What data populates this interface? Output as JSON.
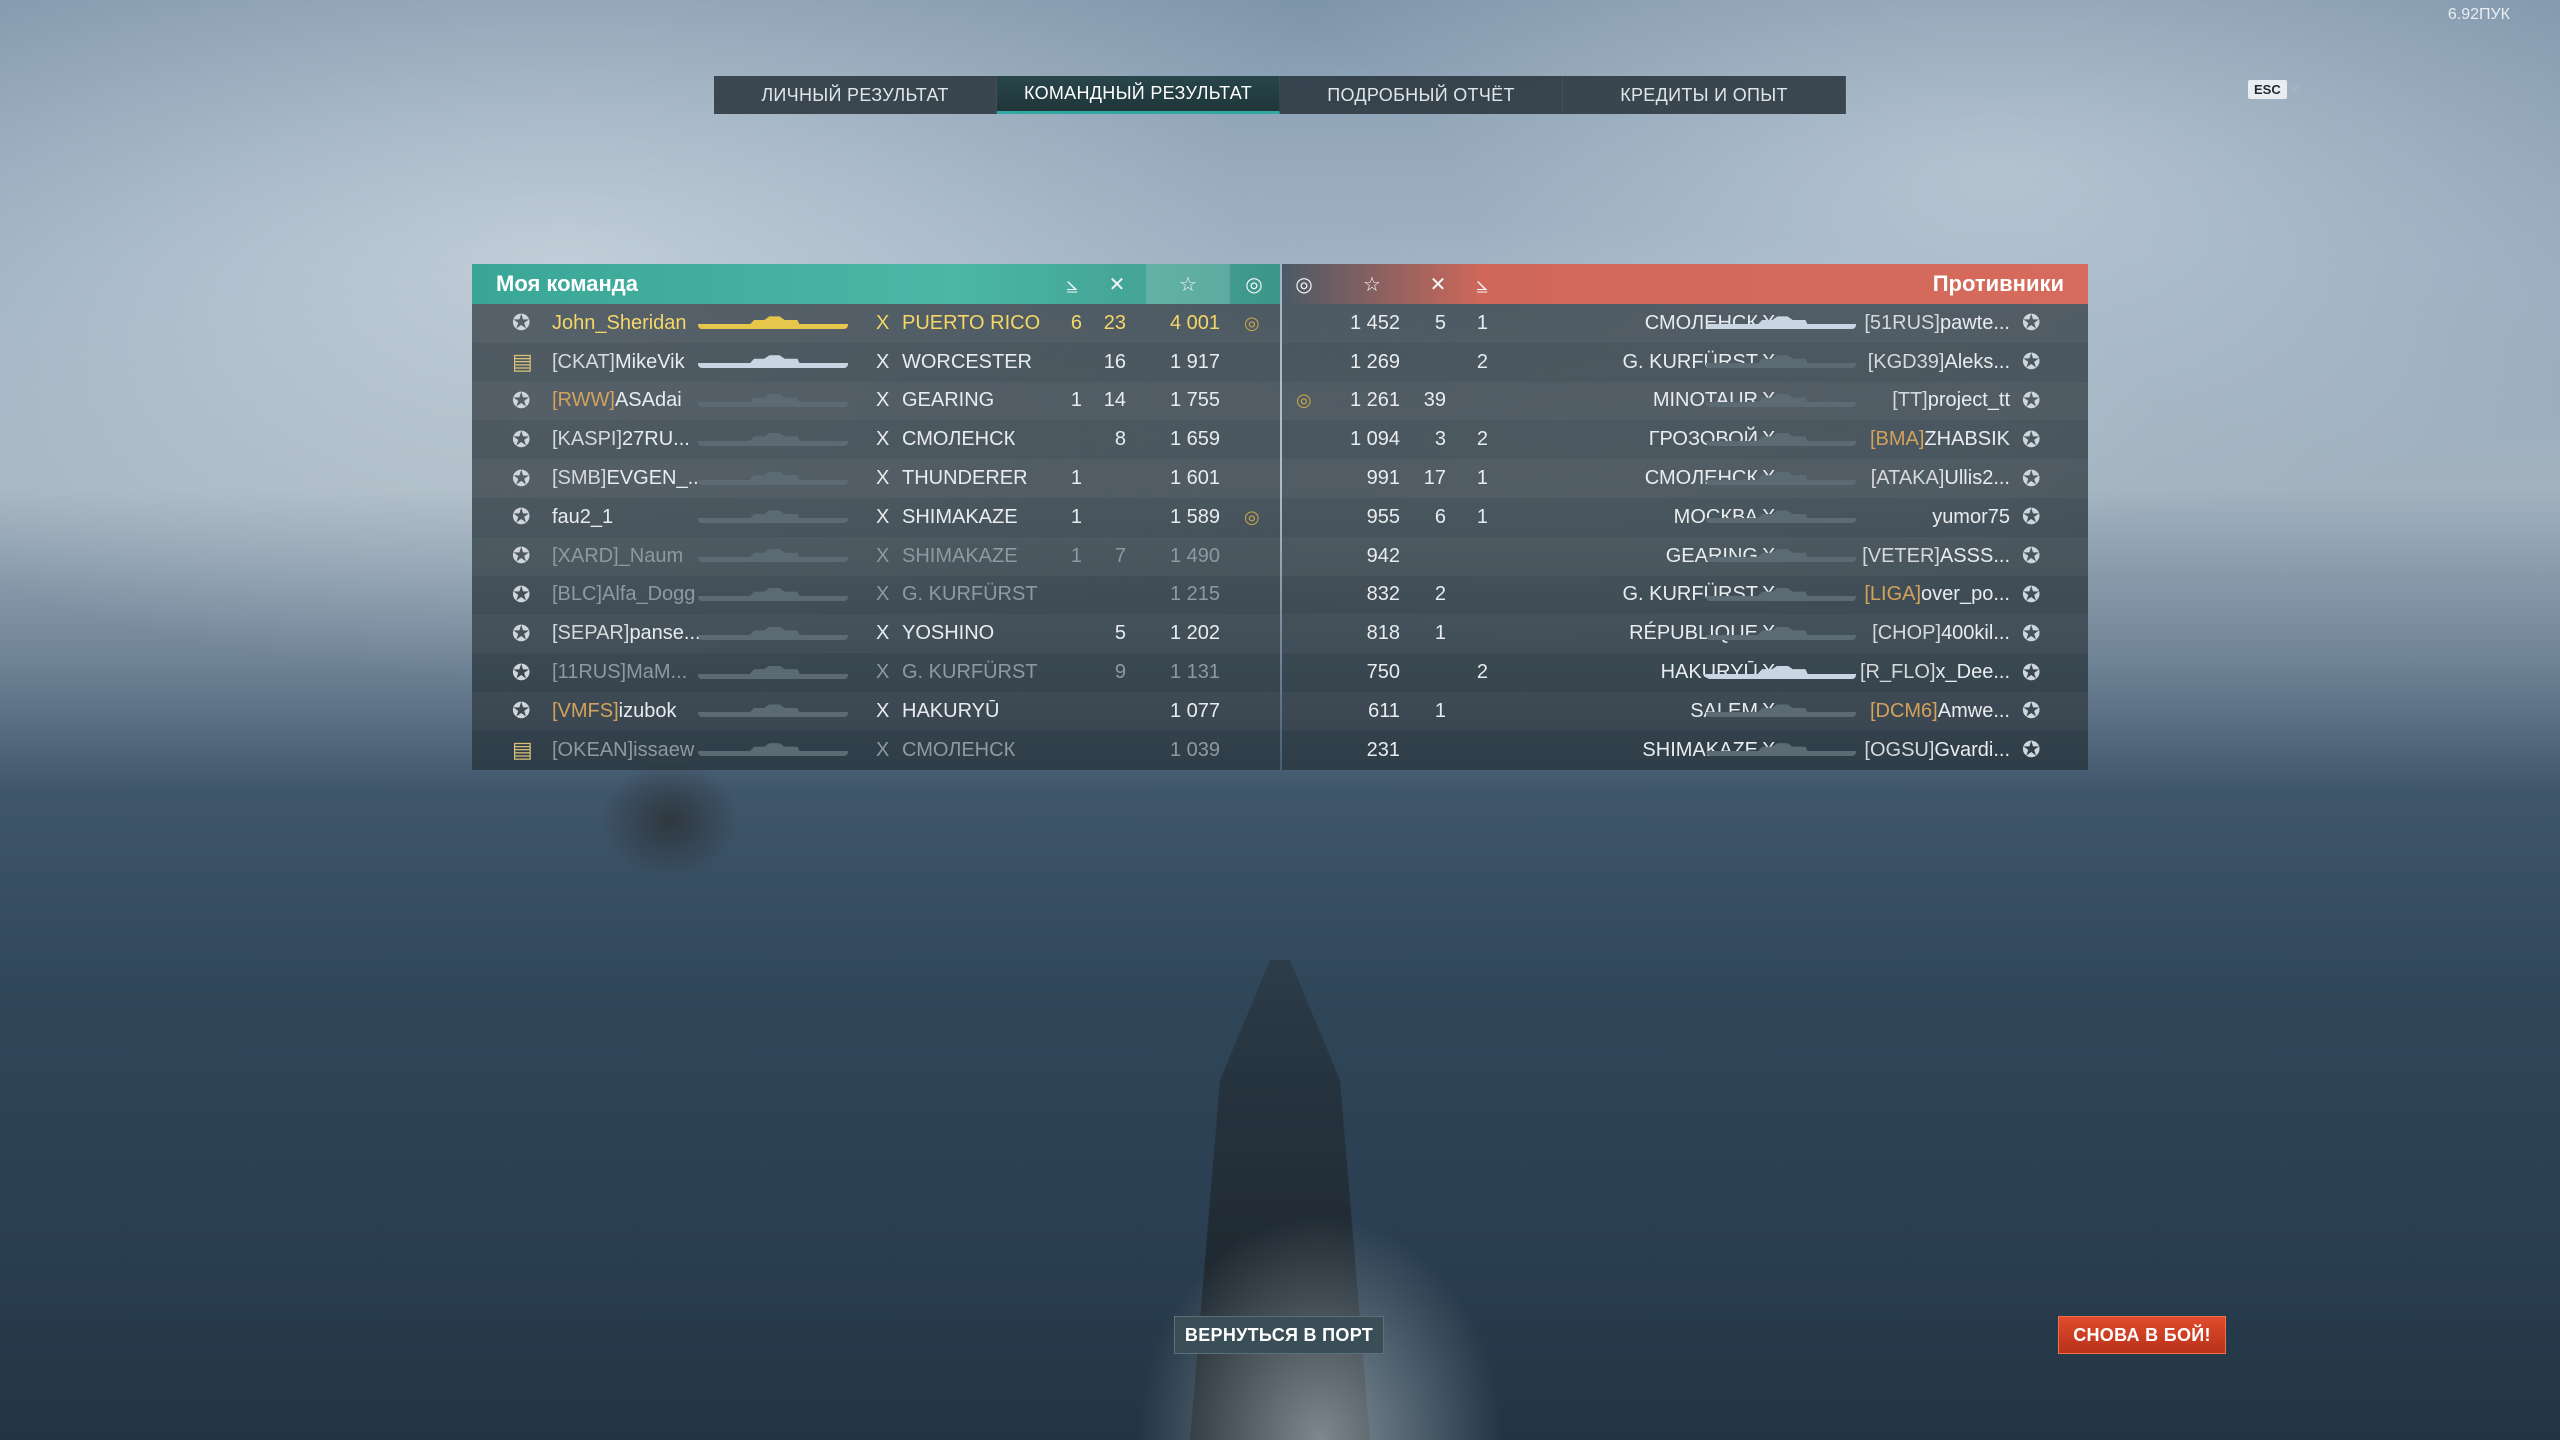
{
  "version": "6.92ПУК",
  "esc_label": "ESC",
  "close_glyph": "×",
  "tabs": [
    {
      "label": "ЛИЧНЫЙ РЕЗУЛЬТАТ",
      "active": false
    },
    {
      "label": "КОМАНДНЫЙ РЕЗУЛЬТАТ",
      "active": true
    },
    {
      "label": "ПОДРОБНЫЙ ОТЧЁТ",
      "active": false
    },
    {
      "label": "КРЕДИТЫ И ОПЫТ",
      "active": false
    }
  ],
  "my_team": {
    "title": "Моя команда",
    "header_icons": {
      "planes": "⦥",
      "kills": "✕",
      "xp": "☆",
      "base": "◎"
    },
    "rows": [
      {
        "clan": "",
        "player": "John_Sheridan",
        "tier": "X",
        "ship": "PUERTO RICO",
        "planes": "6",
        "kills": "23",
        "xp": "4 001",
        "base": "◎",
        "me": true
      },
      {
        "clan": "[CKAT]",
        "player": "MikeVik",
        "tier": "X",
        "ship": "WORCESTER",
        "planes": "",
        "kills": "16",
        "xp": "1 917",
        "base": ""
      },
      {
        "clan": "[RWW]",
        "player": "ASAdai",
        "tier": "X",
        "ship": "GEARING",
        "planes": "1",
        "kills": "14",
        "xp": "1 755",
        "base": "",
        "gold": true
      },
      {
        "clan": "[KASPI]",
        "player": "27RU...",
        "tier": "X",
        "ship": "СМОЛЕНСК",
        "planes": "",
        "kills": "8",
        "xp": "1 659",
        "base": ""
      },
      {
        "clan": "[SMB]",
        "player": "EVGEN_...",
        "tier": "X",
        "ship": "THUNDERER",
        "planes": "1",
        "kills": "",
        "xp": "1 601",
        "base": ""
      },
      {
        "clan": "",
        "player": "fau2_1",
        "tier": "X",
        "ship": "SHIMAKAZE",
        "planes": "1",
        "kills": "",
        "xp": "1 589",
        "base": "◎"
      },
      {
        "clan": "[XARD]",
        "player": "_Naum",
        "tier": "X",
        "ship": "SHIMAKAZE",
        "planes": "1",
        "kills": "7",
        "xp": "1 490",
        "base": "",
        "dead": true
      },
      {
        "clan": "[BLC]",
        "player": "Alfa_Dogg",
        "tier": "X",
        "ship": "G. KURFÜRST",
        "planes": "",
        "kills": "",
        "xp": "1 215",
        "base": "",
        "dead": true,
        "gold": true
      },
      {
        "clan": "[SEPAR]",
        "player": "panse...",
        "tier": "X",
        "ship": "YOSHINO",
        "planes": "",
        "kills": "5",
        "xp": "1 202",
        "base": ""
      },
      {
        "clan": "[11RUS]",
        "player": "MaM...",
        "tier": "X",
        "ship": "G. KURFÜRST",
        "planes": "",
        "kills": "9",
        "xp": "1 131",
        "base": "",
        "dead": true,
        "gold": true
      },
      {
        "clan": "[VMFS]",
        "player": "izubok",
        "tier": "X",
        "ship": "HAKURYŪ",
        "planes": "",
        "kills": "",
        "xp": "1 077",
        "base": "",
        "gold": true
      },
      {
        "clan": "[OKEAN]",
        "player": "issaew",
        "tier": "X",
        "ship": "СМОЛЕНСК",
        "planes": "",
        "kills": "",
        "xp": "1 039",
        "base": "",
        "dead": true
      }
    ]
  },
  "enemy_team": {
    "title": "Противники",
    "rows": [
      {
        "base": "",
        "xp": "1 452",
        "kills": "5",
        "planes": "1",
        "ship": "СМОЛЕНСК",
        "tier": "X",
        "clan": "[51RUS]",
        "player": "pawte..."
      },
      {
        "base": "",
        "xp": "1 269",
        "kills": "",
        "planes": "2",
        "ship": "G. KURFÜRST",
        "tier": "X",
        "clan": "[KGD39]",
        "player": "Aleks..."
      },
      {
        "base": "◎",
        "xp": "1 261",
        "kills": "39",
        "planes": "",
        "ship": "MINOTAUR",
        "tier": "X",
        "clan": "[TT]",
        "player": "project_tt"
      },
      {
        "base": "",
        "xp": "1 094",
        "kills": "3",
        "planes": "2",
        "ship": "ГРОЗОВОЙ",
        "tier": "X",
        "clan": "[BMA]",
        "player": "ZHABSIK",
        "gold": true
      },
      {
        "base": "",
        "xp": "991",
        "kills": "17",
        "planes": "1",
        "ship": "СМОЛЕНСК",
        "tier": "X",
        "clan": "[ATAKA]",
        "player": "Ullis2..."
      },
      {
        "base": "",
        "xp": "955",
        "kills": "6",
        "planes": "1",
        "ship": "МОСКВА",
        "tier": "X",
        "clan": "",
        "player": "yumor75"
      },
      {
        "base": "",
        "xp": "942",
        "kills": "",
        "planes": "",
        "ship": "GEARING",
        "tier": "X",
        "clan": "[VETER]",
        "player": "ASSS..."
      },
      {
        "base": "",
        "xp": "832",
        "kills": "2",
        "planes": "",
        "ship": "G. KURFÜRST",
        "tier": "X",
        "clan": "[LIGA]",
        "player": "over_po...",
        "gold": true
      },
      {
        "base": "",
        "xp": "818",
        "kills": "1",
        "planes": "",
        "ship": "RÉPUBLIQUE",
        "tier": "X",
        "clan": "[CHOP]",
        "player": "400kil..."
      },
      {
        "base": "",
        "xp": "750",
        "kills": "",
        "planes": "2",
        "ship": "HAKURYŪ",
        "tier": "X",
        "clan": "[R_FLO]",
        "player": "x_Dee..."
      },
      {
        "base": "",
        "xp": "611",
        "kills": "1",
        "planes": "",
        "ship": "SALEM",
        "tier": "X",
        "clan": "[DCM6]",
        "player": "Amwe...",
        "gold": true
      },
      {
        "base": "",
        "xp": "231",
        "kills": "",
        "planes": "",
        "ship": "SHIMAKAZE",
        "tier": "X",
        "clan": "[OGSU]",
        "player": "Gvardi..."
      }
    ]
  },
  "buttons": {
    "return_port": "ВЕРНУТЬСЯ В ПОРТ",
    "battle_again": "СНОВА В БОЙ!"
  }
}
